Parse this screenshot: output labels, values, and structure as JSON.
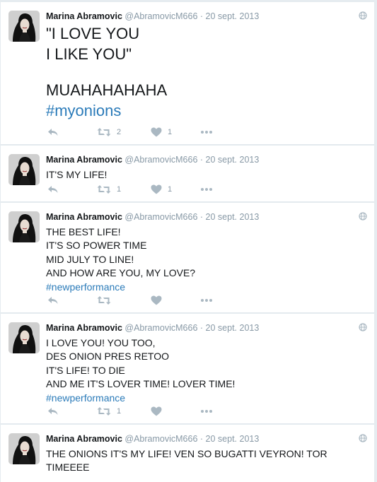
{
  "tweets": [
    {
      "name": "Marina Abramovic",
      "handle": "@AbramovicM666",
      "sep": "·",
      "date": "20 sept. 2013",
      "lines": [
        "\"I LOVE YOU",
        "I LIKE YOU\"",
        "",
        "MUAHAHAHAHA"
      ],
      "hashtag": "#myonions",
      "retweets": "2",
      "likes": "1",
      "globe": true
    },
    {
      "name": "Marina Abramovic",
      "handle": "@AbramovicM666",
      "sep": "·",
      "date": "20 sept. 2013",
      "lines": [
        "IT'S MY LIFE!"
      ],
      "hashtag": "",
      "retweets": "1",
      "likes": "1",
      "globe": false
    },
    {
      "name": "Marina Abramovic",
      "handle": "@AbramovicM666",
      "sep": "·",
      "date": "20 sept. 2013",
      "lines": [
        "THE BEST LIFE!",
        "IT'S SO POWER TIME",
        "MID JULY TO LINE!",
        "AND HOW ARE YOU, MY LOVE?"
      ],
      "hashtag": "#newperformance",
      "retweets": "",
      "likes": "",
      "globe": true
    },
    {
      "name": "Marina Abramovic",
      "handle": "@AbramovicM666",
      "sep": "·",
      "date": "20 sept. 2013",
      "lines": [
        "I LOVE YOU! YOU TOO,",
        "DES ONION PRES RETOO",
        "IT'S LIFE! TO DIE",
        "AND ME IT'S LOVER TIME! LOVER TIME!"
      ],
      "hashtag": "#newperformance",
      "retweets": "1",
      "likes": "",
      "globe": true
    },
    {
      "name": "Marina Abramovic",
      "handle": "@AbramovicM666",
      "sep": "·",
      "date": "20 sept. 2013",
      "lines": [
        "THE ONIONS IT'S MY LIFE! VEN SO BUGATTI VEYRON! TOR",
        "TIMEEEE"
      ],
      "hashtag": "",
      "retweets": "",
      "likes": "",
      "globe": true
    }
  ],
  "icons": {
    "reply": "reply-icon",
    "retweet": "retweet-icon",
    "like": "heart-icon",
    "more": "more-dots-icon",
    "globe": "globe-icon"
  },
  "colors": {
    "hashtag": "#2b7bb9",
    "meta": "#8899a6",
    "action_icon": "#aab8c2",
    "background": "#e6ecf0"
  }
}
